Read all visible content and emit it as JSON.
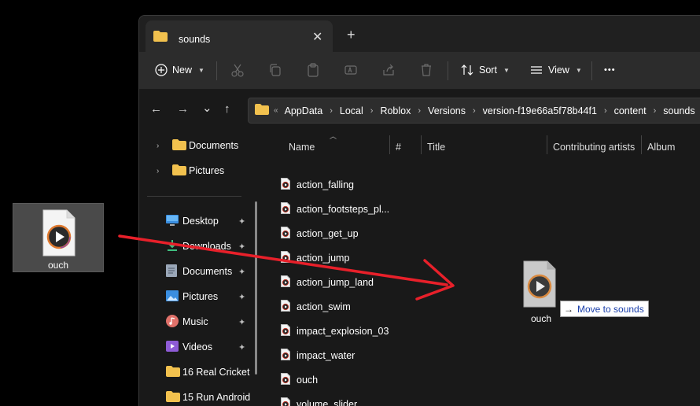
{
  "desktop": {
    "file_label": "ouch"
  },
  "window": {
    "tab_title": "sounds",
    "tab_close": "✕",
    "new_tab": "+"
  },
  "toolbar": {
    "new_label": "New",
    "sort_label": "Sort",
    "view_label": "View",
    "more_label": "•••"
  },
  "nav": {
    "back": "←",
    "forward": "→",
    "recent": "⌄",
    "up": "↑"
  },
  "address": {
    "crumbs": [
      "AppData",
      "Local",
      "Roblox",
      "Versions",
      "version-f19e66a5f78b44f1",
      "content",
      "sounds"
    ],
    "overflow": "«"
  },
  "sidebar": {
    "items": [
      {
        "label": "Documents",
        "icon": "folder-icon",
        "expandable": true
      },
      {
        "label": "Pictures",
        "icon": "folder-icon",
        "expandable": true
      },
      {
        "label": "Desktop",
        "icon": "desktop-icon",
        "pinned": true
      },
      {
        "label": "Downloads",
        "icon": "download-icon",
        "pinned": true
      },
      {
        "label": "Documents",
        "icon": "document-icon",
        "pinned": true
      },
      {
        "label": "Pictures",
        "icon": "picture-icon",
        "pinned": true
      },
      {
        "label": "Music",
        "icon": "music-icon",
        "pinned": true
      },
      {
        "label": "Videos",
        "icon": "video-icon",
        "pinned": true
      },
      {
        "label": "16 Real Cricket",
        "icon": "folder-icon"
      },
      {
        "label": "15 Run Android",
        "icon": "folder-icon"
      }
    ],
    "pin_glyph": "📌"
  },
  "columns": {
    "name": "Name",
    "number": "#",
    "title": "Title",
    "contributing": "Contributing artists",
    "album": "Album"
  },
  "files": [
    "action_falling",
    "action_footsteps_pl...",
    "action_get_up",
    "action_jump",
    "action_jump_land",
    "action_swim",
    "impact_explosion_03",
    "impact_water",
    "ouch",
    "volume_slider"
  ],
  "drag": {
    "ghost_label": "ouch",
    "tooltip_arrow": "→",
    "tooltip_text": "Move to sounds"
  },
  "colors": {
    "folder": "#f2c14e",
    "annotation_arrow": "#e8202a",
    "audio_ring": "#c0392b"
  }
}
